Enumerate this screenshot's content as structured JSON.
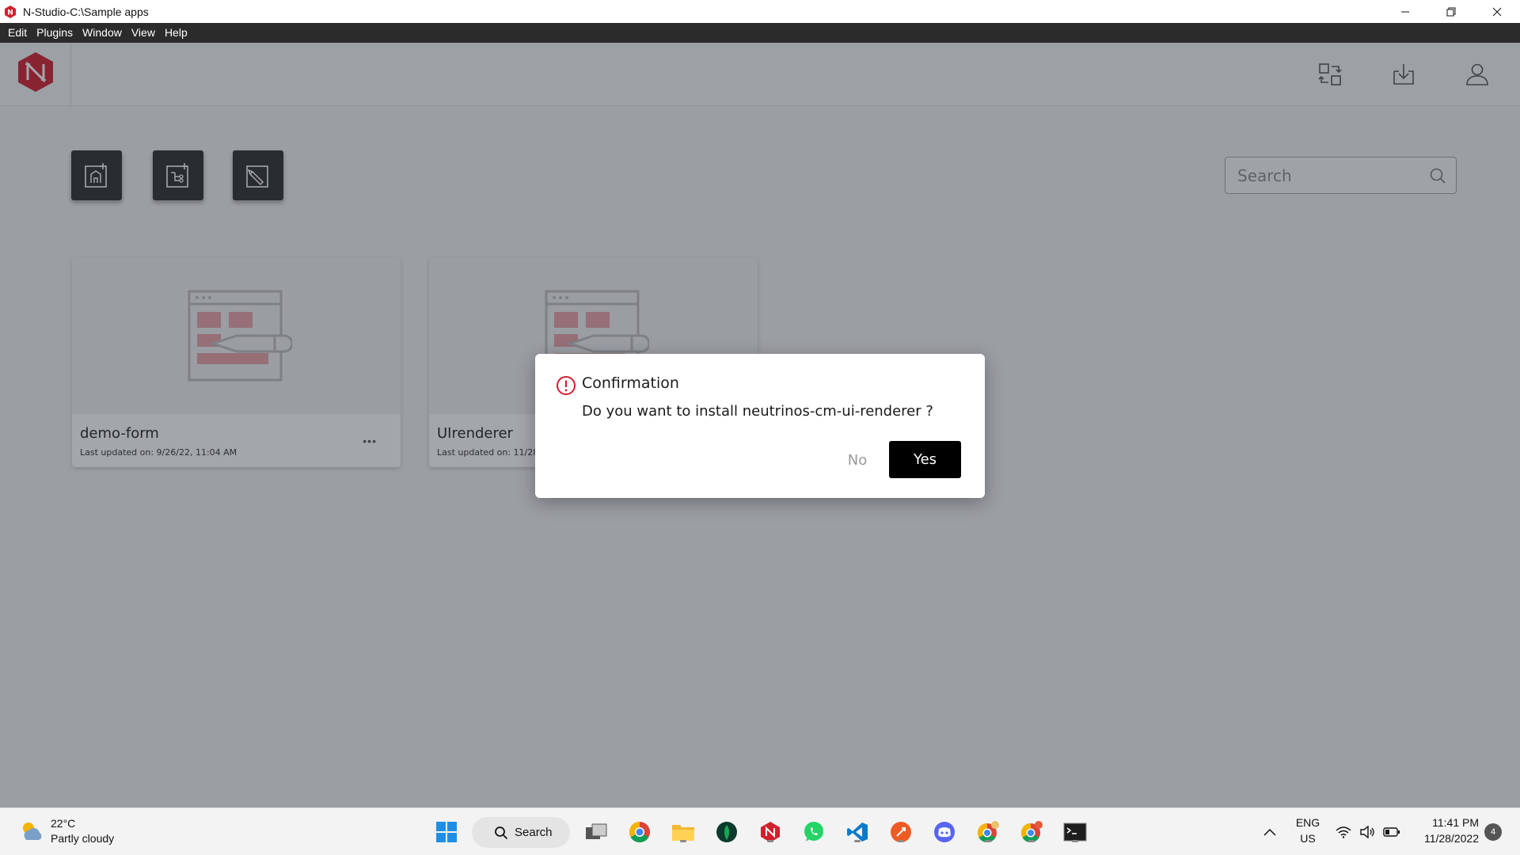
{
  "window": {
    "title": "N-Studio-C:\\Sample apps"
  },
  "menu": [
    "Edit",
    "Plugins",
    "Window",
    "View",
    "Help"
  ],
  "header": {
    "icons": [
      "switch-project-icon",
      "download-icon",
      "user-icon"
    ]
  },
  "toolbar": {
    "buttons": [
      "new-app-icon",
      "new-flow-icon",
      "new-design-icon"
    ]
  },
  "search": {
    "placeholder": "Search",
    "value": ""
  },
  "cards": [
    {
      "name": "demo-form",
      "updated": "Last updated on: 9/26/22, 11:04 AM"
    },
    {
      "name": "UIrenderer",
      "updated": "Last updated on: 11/28/"
    }
  ],
  "dialog": {
    "title": "Confirmation",
    "message": "Do you want to install neutrinos-cm-ui-renderer ?",
    "no_label": "No",
    "yes_label": "Yes"
  },
  "taskbar": {
    "weather": {
      "temp": "22°C",
      "condition": "Partly cloudy"
    },
    "search_label": "Search",
    "lang_top": "ENG",
    "lang_bottom": "US",
    "time": "11:41 PM",
    "date": "11/28/2022",
    "notifications": "4"
  },
  "colors": {
    "brand_red": "#d0202e",
    "dialog_button": "#000000",
    "overlay": "rgba(35,42,54,0.42)"
  }
}
